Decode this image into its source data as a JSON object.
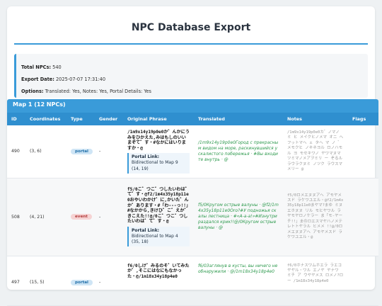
{
  "header": {
    "title": "NPC Database Export"
  },
  "summary": {
    "total_label": "Total NPCs:",
    "total_value": " 540",
    "date_label": "Export Date:",
    "date_value": " 2025-07-07 17:31:40",
    "options_label": "Options:",
    "options_value": " Translated: Yes, Notes: Yes, Portal Details: Yes"
  },
  "map": {
    "title": "Map 1 (12 NPCs)"
  },
  "columns": [
    "ID",
    "Coordinates",
    "Type",
    "Gender",
    "Original Phrase",
    "Translated",
    "Notes",
    "Flags"
  ],
  "rows": [
    {
      "id": "490",
      "coords": "(3, 6)",
      "type": "portal",
      "gender": "-",
      "original": "/1m9x14y19p0e0か゛んかにうみをひかえた,みはもしのいいまぞて゛す・#なかにはいりますか・@",
      "portal_label": "Portal Link:",
      "portal_detail": "Bidirectional to Map 9 (14, 19)",
      "translated": "/1m9x14y19p0e0Город с прекрасным видом на море, раскинувшийся у скалистого побережья · #Вы входите внутрь · @",
      "notes": "/1m9x14y19p0e0カ゛ノマノ ミ ヒ メイクヒノメマ オニ へ フットマヘ ェ タヘ マ ノ ゛ メモクヒ ノキネヨル ロノハモル ヨ モセキワノ ヤワマヌマ ツミマノメアヲミリ ー ぞるル ラウラクヌミ ノツク ラウスマメリー @"
    },
    {
      "id": "508",
      "coords": "(4, 21)",
      "type": "event",
      "gender": "-",
      "original": "f5/0こ゛つこ゛つしたいわは゛て゛す・@f2/1m4x35y18p11e0おやいわかけ゛に,かいた゛んか゛あります・#「わ---っ!!」#なかから,きけひ゛こ゛えか゛きこえた!!@/0こ゛つこ゛つしたいわは゛て゛す・@",
      "portal_label": "Portal Link:",
      "portal_detail": "Bidirectional to Map 4 (35, 18)",
      "translated": "f5/0Кругом острые валуны · @f2/1m4x35y18p11e0Oro?#У подножья скалы лестница · #«А-а-а!»#Изнутри раздался крик!!@/0Кругом острые валуны · @",
      "notes": "f5/0ロメエヌヌアヘ アモヤメスド ラケワユエル・@f2/1m4x35y18p11e0まヤマ?まゆ ミヌエホヌヌ リル モヒヤワル ラヤモヤロノケラー ま「モ-ヤー チ!!」まのロエスマヤハノメテレトトヤラル ヒメメ !!@/0ロメエヌヌアヘ アモヤメスド ラケワユエル・@"
    },
    {
      "id": "497",
      "coords": "(15, 5)",
      "type": "portal",
      "gender": "-",
      "original": "f6/0しけ゛みるのそ゛いてみたか゛,そこにはなにもなかった・@/1m18x34y18p4e0",
      "translated": "f6/0Заглянув в кусты, вы ничего не обнаружили · @/1m18x34y18p4e0",
      "notes": "f6/0ホナスワムホエラ ラエコヤヤル・ワル エノヤ ヤナワ ミチ ア ウヤヤメス ロメノ?ロー /1m18x34y18p4e0"
    }
  ]
}
